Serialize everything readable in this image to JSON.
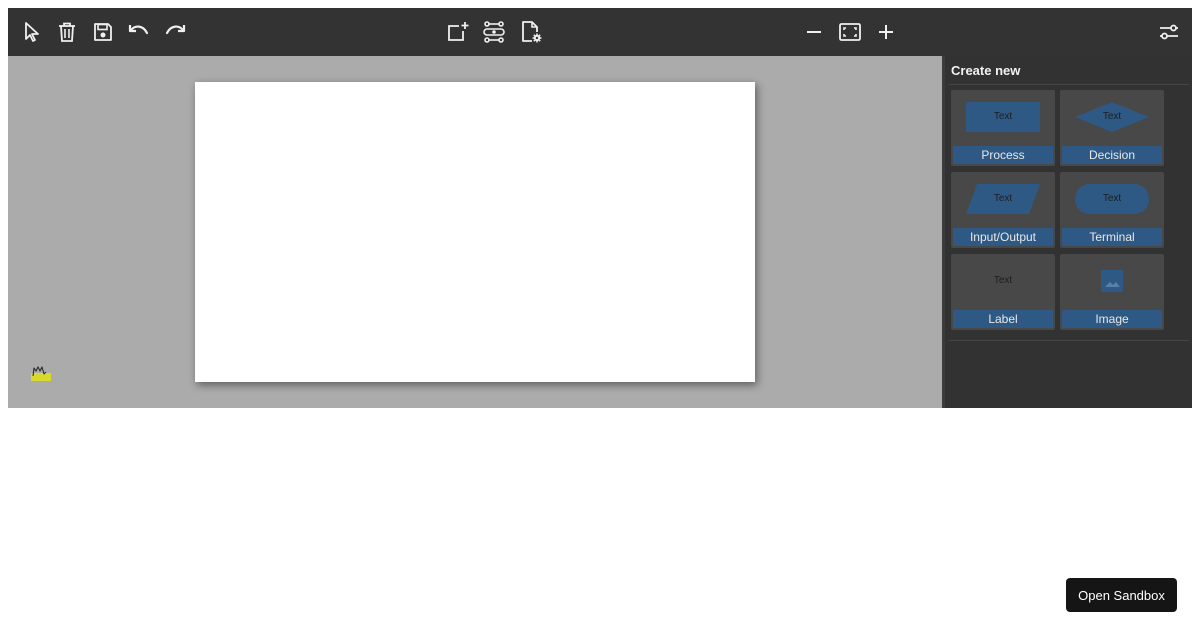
{
  "toolbar": {
    "tools": [
      {
        "name": "pointer",
        "icon": "cursor-icon"
      },
      {
        "name": "delete",
        "icon": "trash-icon"
      },
      {
        "name": "save",
        "icon": "save-icon"
      },
      {
        "name": "undo",
        "icon": "undo-icon"
      },
      {
        "name": "redo",
        "icon": "redo-icon"
      },
      {
        "name": "add-node",
        "icon": "add-node-icon"
      },
      {
        "name": "connector-settings",
        "icon": "route-icon"
      },
      {
        "name": "page-settings",
        "icon": "file-settings-icon"
      },
      {
        "name": "zoom-out",
        "icon": "minus-icon"
      },
      {
        "name": "zoom-fit",
        "icon": "fit-screen-icon"
      },
      {
        "name": "zoom-in",
        "icon": "plus-icon"
      },
      {
        "name": "preferences",
        "icon": "sliders-icon"
      }
    ]
  },
  "canvas": {
    "logo_icon": "signature-logo"
  },
  "sidebar": {
    "title": "Create new",
    "shapes": [
      {
        "label": "Process",
        "text": "Text",
        "shape": "rectangle"
      },
      {
        "label": "Decision",
        "text": "Text",
        "shape": "diamond"
      },
      {
        "label": "Input/Output",
        "text": "Text",
        "shape": "parallelogram"
      },
      {
        "label": "Terminal",
        "text": "Text",
        "shape": "rounded-pill"
      },
      {
        "label": "Label",
        "text": "Text",
        "shape": "none"
      },
      {
        "label": "Image",
        "text": "",
        "shape": "image-icon"
      }
    ]
  },
  "footer": {
    "open_sandbox_label": "Open Sandbox"
  },
  "colors": {
    "toolbar_bg": "#333333",
    "canvas_bg": "#ababab",
    "sidebar_bg": "#323232",
    "shape_fill": "#2e5984",
    "caption_bg": "#2e5984"
  }
}
